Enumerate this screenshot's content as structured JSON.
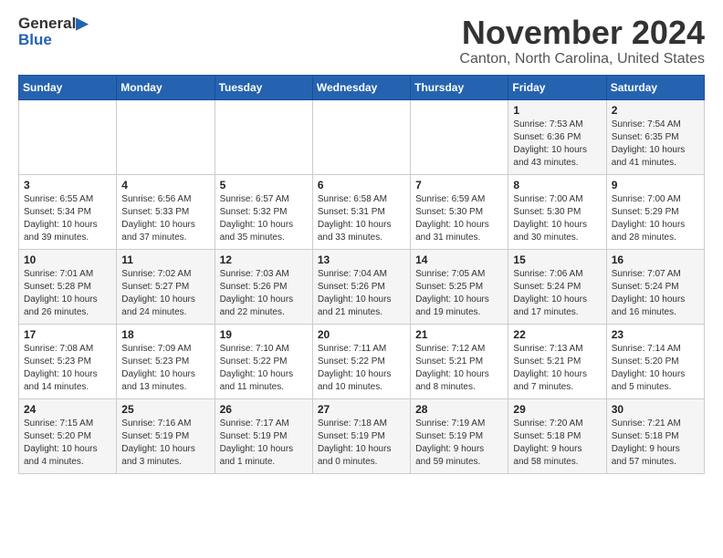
{
  "header": {
    "logo_line1": "General",
    "logo_line2": "Blue",
    "month": "November 2024",
    "location": "Canton, North Carolina, United States"
  },
  "weekdays": [
    "Sunday",
    "Monday",
    "Tuesday",
    "Wednesday",
    "Thursday",
    "Friday",
    "Saturday"
  ],
  "weeks": [
    [
      {
        "day": "",
        "info": ""
      },
      {
        "day": "",
        "info": ""
      },
      {
        "day": "",
        "info": ""
      },
      {
        "day": "",
        "info": ""
      },
      {
        "day": "",
        "info": ""
      },
      {
        "day": "1",
        "info": "Sunrise: 7:53 AM\nSunset: 6:36 PM\nDaylight: 10 hours\nand 43 minutes."
      },
      {
        "day": "2",
        "info": "Sunrise: 7:54 AM\nSunset: 6:35 PM\nDaylight: 10 hours\nand 41 minutes."
      }
    ],
    [
      {
        "day": "3",
        "info": "Sunrise: 6:55 AM\nSunset: 5:34 PM\nDaylight: 10 hours\nand 39 minutes."
      },
      {
        "day": "4",
        "info": "Sunrise: 6:56 AM\nSunset: 5:33 PM\nDaylight: 10 hours\nand 37 minutes."
      },
      {
        "day": "5",
        "info": "Sunrise: 6:57 AM\nSunset: 5:32 PM\nDaylight: 10 hours\nand 35 minutes."
      },
      {
        "day": "6",
        "info": "Sunrise: 6:58 AM\nSunset: 5:31 PM\nDaylight: 10 hours\nand 33 minutes."
      },
      {
        "day": "7",
        "info": "Sunrise: 6:59 AM\nSunset: 5:30 PM\nDaylight: 10 hours\nand 31 minutes."
      },
      {
        "day": "8",
        "info": "Sunrise: 7:00 AM\nSunset: 5:30 PM\nDaylight: 10 hours\nand 30 minutes."
      },
      {
        "day": "9",
        "info": "Sunrise: 7:00 AM\nSunset: 5:29 PM\nDaylight: 10 hours\nand 28 minutes."
      }
    ],
    [
      {
        "day": "10",
        "info": "Sunrise: 7:01 AM\nSunset: 5:28 PM\nDaylight: 10 hours\nand 26 minutes."
      },
      {
        "day": "11",
        "info": "Sunrise: 7:02 AM\nSunset: 5:27 PM\nDaylight: 10 hours\nand 24 minutes."
      },
      {
        "day": "12",
        "info": "Sunrise: 7:03 AM\nSunset: 5:26 PM\nDaylight: 10 hours\nand 22 minutes."
      },
      {
        "day": "13",
        "info": "Sunrise: 7:04 AM\nSunset: 5:26 PM\nDaylight: 10 hours\nand 21 minutes."
      },
      {
        "day": "14",
        "info": "Sunrise: 7:05 AM\nSunset: 5:25 PM\nDaylight: 10 hours\nand 19 minutes."
      },
      {
        "day": "15",
        "info": "Sunrise: 7:06 AM\nSunset: 5:24 PM\nDaylight: 10 hours\nand 17 minutes."
      },
      {
        "day": "16",
        "info": "Sunrise: 7:07 AM\nSunset: 5:24 PM\nDaylight: 10 hours\nand 16 minutes."
      }
    ],
    [
      {
        "day": "17",
        "info": "Sunrise: 7:08 AM\nSunset: 5:23 PM\nDaylight: 10 hours\nand 14 minutes."
      },
      {
        "day": "18",
        "info": "Sunrise: 7:09 AM\nSunset: 5:23 PM\nDaylight: 10 hours\nand 13 minutes."
      },
      {
        "day": "19",
        "info": "Sunrise: 7:10 AM\nSunset: 5:22 PM\nDaylight: 10 hours\nand 11 minutes."
      },
      {
        "day": "20",
        "info": "Sunrise: 7:11 AM\nSunset: 5:22 PM\nDaylight: 10 hours\nand 10 minutes."
      },
      {
        "day": "21",
        "info": "Sunrise: 7:12 AM\nSunset: 5:21 PM\nDaylight: 10 hours\nand 8 minutes."
      },
      {
        "day": "22",
        "info": "Sunrise: 7:13 AM\nSunset: 5:21 PM\nDaylight: 10 hours\nand 7 minutes."
      },
      {
        "day": "23",
        "info": "Sunrise: 7:14 AM\nSunset: 5:20 PM\nDaylight: 10 hours\nand 5 minutes."
      }
    ],
    [
      {
        "day": "24",
        "info": "Sunrise: 7:15 AM\nSunset: 5:20 PM\nDaylight: 10 hours\nand 4 minutes."
      },
      {
        "day": "25",
        "info": "Sunrise: 7:16 AM\nSunset: 5:19 PM\nDaylight: 10 hours\nand 3 minutes."
      },
      {
        "day": "26",
        "info": "Sunrise: 7:17 AM\nSunset: 5:19 PM\nDaylight: 10 hours\nand 1 minute."
      },
      {
        "day": "27",
        "info": "Sunrise: 7:18 AM\nSunset: 5:19 PM\nDaylight: 10 hours\nand 0 minutes."
      },
      {
        "day": "28",
        "info": "Sunrise: 7:19 AM\nSunset: 5:19 PM\nDaylight: 9 hours\nand 59 minutes."
      },
      {
        "day": "29",
        "info": "Sunrise: 7:20 AM\nSunset: 5:18 PM\nDaylight: 9 hours\nand 58 minutes."
      },
      {
        "day": "30",
        "info": "Sunrise: 7:21 AM\nSunset: 5:18 PM\nDaylight: 9 hours\nand 57 minutes."
      }
    ]
  ]
}
